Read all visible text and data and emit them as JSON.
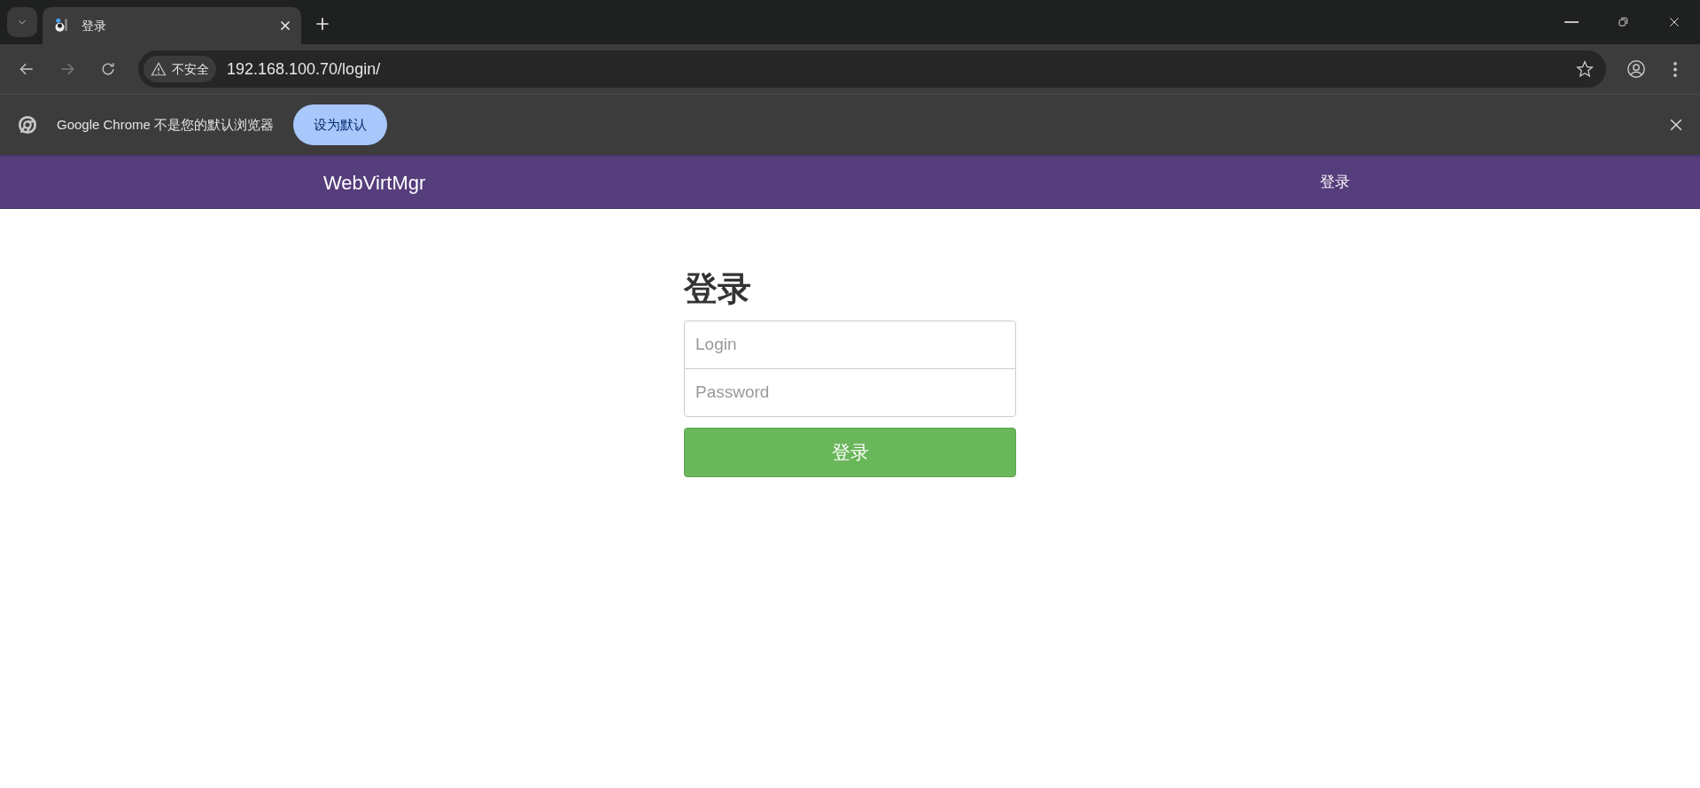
{
  "browser": {
    "tabs": [
      {
        "title": "登录",
        "selected": true
      }
    ],
    "security_label": "不安全",
    "url": "192.168.100.70/login/",
    "infobar": {
      "message": "Google Chrome 不是您的默认浏览器",
      "button": "设为默认"
    }
  },
  "navbar": {
    "brand": "WebVirtMgr",
    "links": [
      {
        "label": "登录",
        "selected": false
      }
    ]
  },
  "login": {
    "heading": "登录",
    "fields": [
      {
        "placeholder": "Login"
      },
      {
        "placeholder": "Password"
      }
    ],
    "submit": "登录"
  }
}
